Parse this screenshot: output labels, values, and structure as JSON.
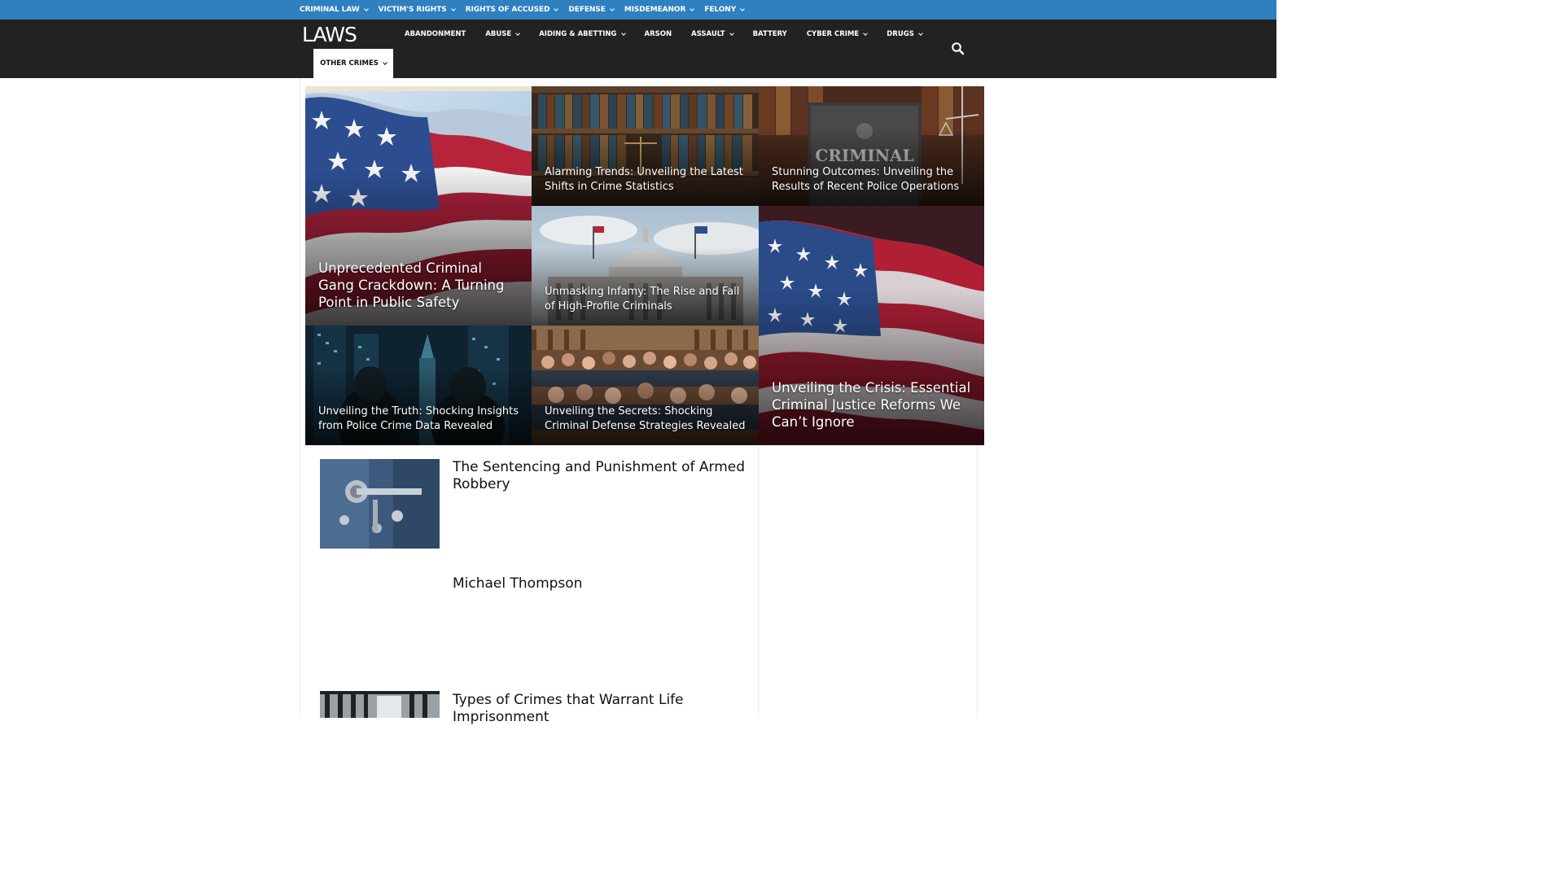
{
  "topbar": {
    "items": [
      {
        "label": "CRIMINAL LAW"
      },
      {
        "label": "VICTIM'S RIGHTS"
      },
      {
        "label": "RIGHTS OF ACCUSED"
      },
      {
        "label": "DEFENSE"
      },
      {
        "label": "MISDEMEANOR"
      },
      {
        "label": "FELONY"
      }
    ]
  },
  "header": {
    "logo": "LAWS",
    "nav": [
      {
        "label": "ABANDONMENT"
      },
      {
        "label": "ABUSE"
      },
      {
        "label": "AIDING & ABETTING"
      },
      {
        "label": "ARSON"
      },
      {
        "label": "ASSAULT"
      },
      {
        "label": "BATTERY"
      },
      {
        "label": "CYBER CRIME"
      },
      {
        "label": "DRUGS"
      }
    ],
    "other": "OTHER CRIMES",
    "search_icon": "search-icon"
  },
  "featured": [
    {
      "title": "Unprecedented Criminal Gang Crackdown: A Turning Point in Public Safety"
    },
    {
      "title": "Alarming Trends: Unveiling the Latest Shifts in Crime Statistics"
    },
    {
      "title": "Stunning Outcomes: Unveiling the Results of Recent Police Operations"
    },
    {
      "title": "Unmasking Infamy: The Rise and Fall of High-Profile Criminals"
    },
    {
      "title": "Unveiling the Crisis: Essential Criminal Justice Reforms We Can’t Ignore"
    },
    {
      "title": "Unveiling the Truth: Shocking Insights from Police Crime Data Revealed"
    },
    {
      "title": "Unveiling the Secrets: Shocking Criminal Defense Strategies Revealed"
    }
  ],
  "articles": [
    {
      "title": "The Sentencing and Punishment of Armed Robbery"
    },
    {
      "title": "Michael Thompson"
    },
    {
      "title": "Types of Crimes that Warrant Life Imprisonment"
    }
  ],
  "colors": {
    "topbar": "#2f80c0",
    "header": "#222222",
    "text": "#111111"
  }
}
